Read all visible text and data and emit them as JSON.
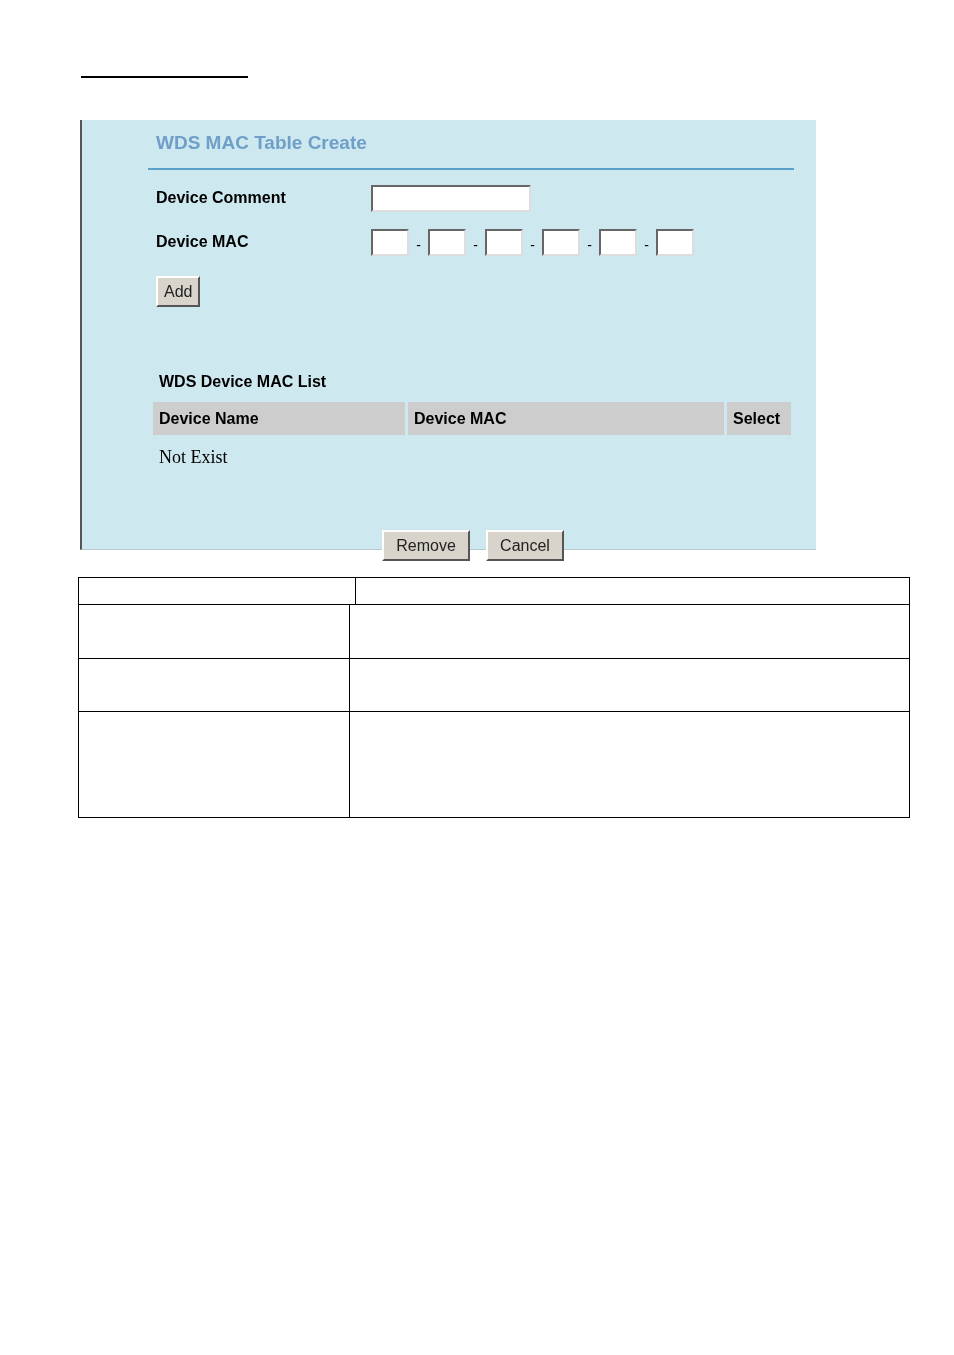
{
  "panel": {
    "title": "WDS MAC Table Create",
    "device_comment": {
      "label": "Device Comment"
    },
    "device_mac": {
      "label": "Device MAC",
      "separators": [
        "-",
        "-",
        "-",
        "-",
        "-"
      ]
    },
    "add_button": "Add",
    "list": {
      "title": "WDS Device MAC List",
      "columns": [
        "Device Name",
        "Device MAC",
        "Select"
      ],
      "empty_message": "Not Exist"
    },
    "buttons": [
      "Remove",
      "Cancel"
    ]
  }
}
